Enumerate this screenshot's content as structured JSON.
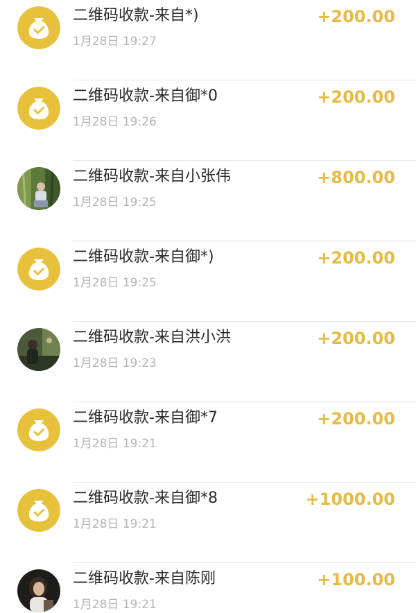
{
  "colors": {
    "accent": "#e6bb45",
    "icon_bg": "#e8c13c",
    "title": "#2b2b2b",
    "time": "#b4b4b4",
    "divider": "#e6e6e6"
  },
  "transactions": [
    {
      "title": "二维码收款-来自*)",
      "time": "1月28日 19:27",
      "amount": "+200.00",
      "icon": "money-bag-icon"
    },
    {
      "title": "二维码收款-来自御*0",
      "time": "1月28日 19:26",
      "amount": "+200.00",
      "icon": "money-bag-icon"
    },
    {
      "title": "二维码收款-来自小张伟",
      "time": "1月28日 19:25",
      "amount": "+800.00",
      "icon": "user-avatar"
    },
    {
      "title": "二维码收款-来自御*)",
      "time": "1月28日 19:25",
      "amount": "+200.00",
      "icon": "money-bag-icon"
    },
    {
      "title": "二维码收款-来自洪小洪",
      "time": "1月28日 19:23",
      "amount": "+200.00",
      "icon": "user-avatar"
    },
    {
      "title": "二维码收款-来自御*7",
      "time": "1月28日 19:21",
      "amount": "+200.00",
      "icon": "money-bag-icon"
    },
    {
      "title": "二维码收款-来自御*8",
      "time": "1月28日 19:21",
      "amount": "+1000.00",
      "icon": "money-bag-icon"
    },
    {
      "title": "二维码收款-来自陈刚",
      "time": "1月28日 19:21",
      "amount": "+100.00",
      "icon": "user-avatar"
    }
  ]
}
